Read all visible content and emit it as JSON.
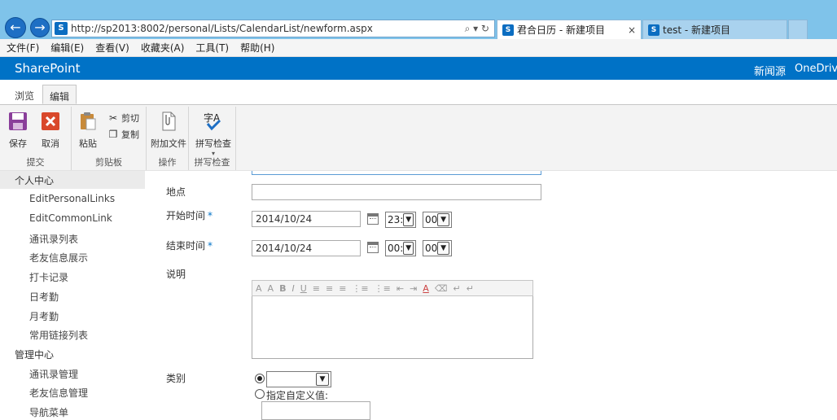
{
  "browser": {
    "address_url": "http://sp2013:8002/personal/Lists/CalendarList/newform.aspx",
    "address_controls": "⌕ ▾ ↻",
    "sp_badge": "S",
    "tabs": [
      {
        "title": "君合日历 - 新建项目",
        "close": "×"
      },
      {
        "title": "test - 新建项目"
      }
    ]
  },
  "menubar": [
    "文件(F)",
    "编辑(E)",
    "查看(V)",
    "收藏夹(A)",
    "工具(T)",
    "帮助(H)"
  ],
  "suitebar": {
    "brand": "SharePoint",
    "links": [
      "新闻源",
      "OneDrive"
    ]
  },
  "ribbon": {
    "tabs": [
      "浏览",
      "编辑"
    ],
    "groups": {
      "submit": {
        "label": "提交",
        "save": "保存",
        "cancel": "取消"
      },
      "clipboard": {
        "label": "剪贴板",
        "paste": "粘贴",
        "cut": "剪切",
        "copy": "复制"
      },
      "actions": {
        "label": "操作",
        "attach": "附加文件"
      },
      "spelling": {
        "label": "拼写检查",
        "spell": "拼写检查"
      }
    },
    "colors": {
      "save": "#8a3e9a",
      "cancel": "#d9482b",
      "brand": "#0072c6"
    }
  },
  "leftnav": [
    {
      "label": "个人中心",
      "level": "head"
    },
    {
      "label": "EditPersonalLinks",
      "level": "sub"
    },
    {
      "label": "EditCommonLink",
      "level": "sub"
    },
    {
      "label": "通讯录列表",
      "level": "sub"
    },
    {
      "label": "老友信息展示",
      "level": "sub"
    },
    {
      "label": "打卡记录",
      "level": "sub"
    },
    {
      "label": "日考勤",
      "level": "sub"
    },
    {
      "label": "月考勤",
      "level": "sub"
    },
    {
      "label": "常用链接列表",
      "level": "sub"
    },
    {
      "label": "管理中心",
      "level": "head"
    },
    {
      "label": "通讯录管理",
      "level": "sub"
    },
    {
      "label": "老友信息管理",
      "level": "sub"
    },
    {
      "label": "导航菜单",
      "level": "sub"
    }
  ],
  "form": {
    "location": {
      "label": "地点",
      "value": ""
    },
    "start": {
      "label": "开始时间",
      "required": "*",
      "date": "2014/10/24",
      "hour": "23:",
      "minute": "00"
    },
    "end": {
      "label": "结束时间",
      "required": "*",
      "date": "2014/10/24",
      "hour": "00:",
      "minute": "00"
    },
    "description": {
      "label": "说明",
      "toolbar": [
        "A",
        "A",
        "B",
        "I",
        "U",
        "≡",
        "≡",
        "≡",
        "⋮≡",
        "⋮≡",
        "⇤",
        "⇥",
        "A",
        "⌫",
        "↵",
        "↵"
      ]
    },
    "category": {
      "label": "类别",
      "selected": "",
      "custom_label": "指定自定义值:",
      "custom_value": ""
    }
  }
}
